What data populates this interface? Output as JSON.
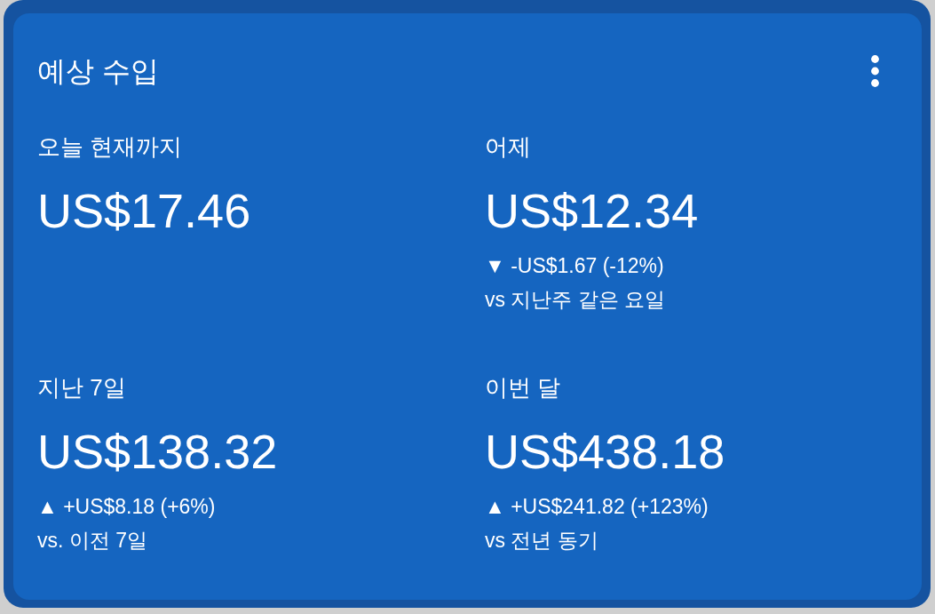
{
  "card": {
    "title": "예상 수입",
    "stats": [
      {
        "label": "오늘 현재까지",
        "value": "US$17.46"
      },
      {
        "label": "어제",
        "value": "US$12.34",
        "change": "▼ -US$1.67 (-12%)",
        "comparison": "vs 지난주 같은 요일"
      },
      {
        "label": "지난 7일",
        "value": "US$138.32",
        "change": "▲ +US$8.18 (+6%)",
        "comparison": "vs. 이전 7일"
      },
      {
        "label": "이번 달",
        "value": "US$438.18",
        "change": "▲ +US$241.82 (+123%)",
        "comparison": "vs 전년 동기"
      }
    ]
  }
}
